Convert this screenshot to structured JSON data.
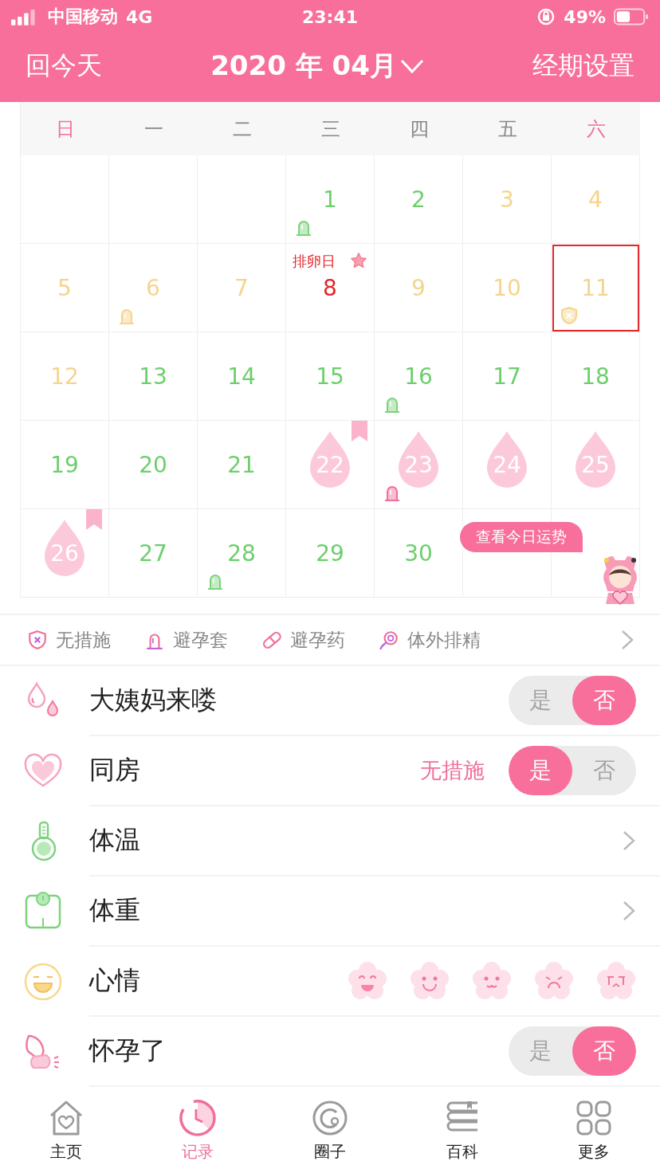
{
  "status_bar": {
    "carrier": "中国移动",
    "network": "4G",
    "time": "23:41",
    "battery": "49%"
  },
  "header": {
    "left": "回今天",
    "title": "2020 年 04月",
    "right": "经期设置"
  },
  "calendar": {
    "weekdays": [
      {
        "label": "日",
        "weekend": true
      },
      {
        "label": "一",
        "weekend": false
      },
      {
        "label": "二",
        "weekend": false
      },
      {
        "label": "三",
        "weekend": false
      },
      {
        "label": "四",
        "weekend": false
      },
      {
        "label": "五",
        "weekend": false
      },
      {
        "label": "六",
        "weekend": true
      }
    ],
    "days": [
      {
        "kind": "empty"
      },
      {
        "kind": "empty"
      },
      {
        "kind": "empty"
      },
      {
        "day": "1",
        "kind": "safe",
        "condom": true
      },
      {
        "day": "2",
        "kind": "safe"
      },
      {
        "day": "3",
        "kind": "fertile"
      },
      {
        "day": "4",
        "kind": "fertile"
      },
      {
        "day": "5",
        "kind": "fertile"
      },
      {
        "day": "6",
        "kind": "fertile",
        "condom": true
      },
      {
        "day": "7",
        "kind": "fertile"
      },
      {
        "day": "8",
        "kind": "ovulation",
        "label": "排卵日"
      },
      {
        "day": "9",
        "kind": "fertile"
      },
      {
        "day": "10",
        "kind": "fertile"
      },
      {
        "day": "11",
        "kind": "fertile",
        "unprotected": true,
        "selected": true
      },
      {
        "day": "12",
        "kind": "fertile"
      },
      {
        "day": "13",
        "kind": "safe"
      },
      {
        "day": "14",
        "kind": "safe"
      },
      {
        "day": "15",
        "kind": "safe"
      },
      {
        "day": "16",
        "kind": "safe",
        "condom": true
      },
      {
        "day": "17",
        "kind": "safe"
      },
      {
        "day": "18",
        "kind": "safe"
      },
      {
        "day": "19",
        "kind": "safe"
      },
      {
        "day": "20",
        "kind": "safe"
      },
      {
        "day": "21",
        "kind": "safe"
      },
      {
        "day": "22",
        "kind": "period",
        "flag": true
      },
      {
        "day": "23",
        "kind": "period",
        "condom": true
      },
      {
        "day": "24",
        "kind": "period"
      },
      {
        "day": "25",
        "kind": "period"
      },
      {
        "day": "26",
        "kind": "period",
        "flag": true
      },
      {
        "day": "27",
        "kind": "safe"
      },
      {
        "day": "28",
        "kind": "safe",
        "condom": true
      },
      {
        "day": "29",
        "kind": "safe"
      },
      {
        "day": "30",
        "kind": "safe"
      },
      {
        "kind": "empty"
      },
      {
        "kind": "empty"
      }
    ],
    "fortune_button": "查看今日运势"
  },
  "legend": [
    {
      "kind": "shield",
      "label": "无措施"
    },
    {
      "kind": "condom",
      "label": "避孕套"
    },
    {
      "kind": "pill",
      "label": "避孕药"
    },
    {
      "kind": "withdrawal",
      "label": "体外排精"
    }
  ],
  "records": [
    {
      "kind": "toggle",
      "label": "大姨妈来喽",
      "options": [
        {
          "label": "是",
          "selected": false
        },
        {
          "label": "否",
          "selected": true
        }
      ]
    },
    {
      "kind": "toggle",
      "label": "同房",
      "note": "无措施",
      "options": [
        {
          "label": "是",
          "selected": true
        },
        {
          "label": "否",
          "selected": false
        }
      ]
    },
    {
      "kind": "arrow",
      "label": "体温"
    },
    {
      "kind": "arrow",
      "label": "体重"
    },
    {
      "kind": "mood",
      "label": "心情"
    },
    {
      "kind": "toggle",
      "label": "怀孕了",
      "options": [
        {
          "label": "是",
          "selected": false
        },
        {
          "label": "否",
          "selected": true
        }
      ]
    }
  ],
  "tab_bar": [
    {
      "label": "主页",
      "selected": false
    },
    {
      "label": "记录",
      "selected": true
    },
    {
      "label": "圈子",
      "selected": false
    },
    {
      "label": "百科",
      "selected": false
    },
    {
      "label": "更多",
      "selected": false
    }
  ]
}
